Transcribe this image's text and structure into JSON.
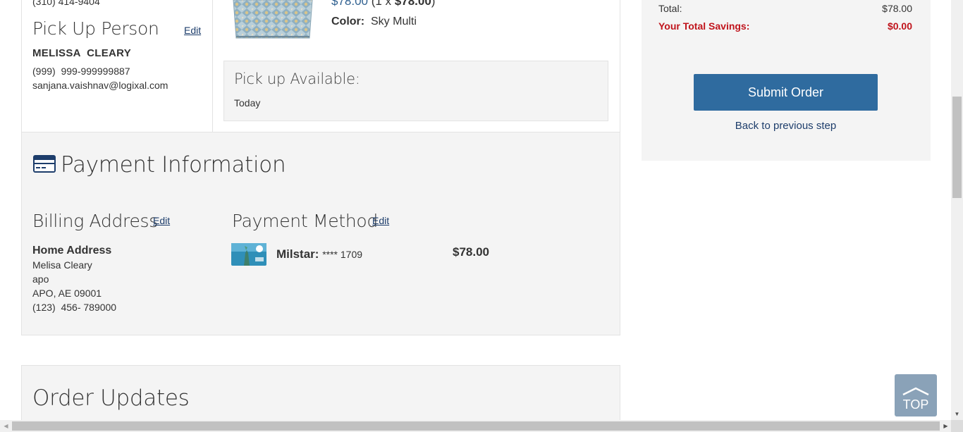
{
  "pickup": {
    "phone_top": "(310) 414-9404",
    "title": "Pick Up Person",
    "edit_label": "Edit",
    "name": "MELISSA  CLEARY",
    "phone": "(999)  999-999999887",
    "email": "sanjana.vaishnav@logixal.com"
  },
  "product": {
    "price": "$78.00",
    "qty_prefix": " (1 x ",
    "qty_price": "$78.00",
    "qty_suffix": ")",
    "color_label": "Color:",
    "color_value": "Sky Multi",
    "pickup_available_title": "Pick up Available:",
    "pickup_available_value": "Today"
  },
  "payment": {
    "title": "Payment Information",
    "billing": {
      "title": "Billing Address",
      "edit_label": "Edit",
      "name": "Home Address",
      "lines": [
        "Melisa Cleary",
        "apo",
        "APO, AE 09001",
        "(123)  456- 789000"
      ]
    },
    "method": {
      "title": "Payment Method",
      "edit_label": "Edit",
      "card_name": "Milstar:",
      "card_number": "**** 1709",
      "amount": "$78.00"
    }
  },
  "updates": {
    "title": "Order Updates"
  },
  "summary": {
    "total_label": "Total:",
    "total_value": "$78.00",
    "savings_label": "Your Total Savings:",
    "savings_value": "$0.00",
    "submit_label": "Submit Order",
    "back_label": "Back to previous step"
  },
  "top_button": {
    "label": "TOP"
  },
  "colors": {
    "accent_blue": "#2f6b9f",
    "link_blue": "#1d3d6b",
    "savings_red": "#c0141c",
    "panel_gray": "#f4f4f4"
  },
  "icons": [
    "credit-card-icon",
    "chevron-up-icon"
  ]
}
